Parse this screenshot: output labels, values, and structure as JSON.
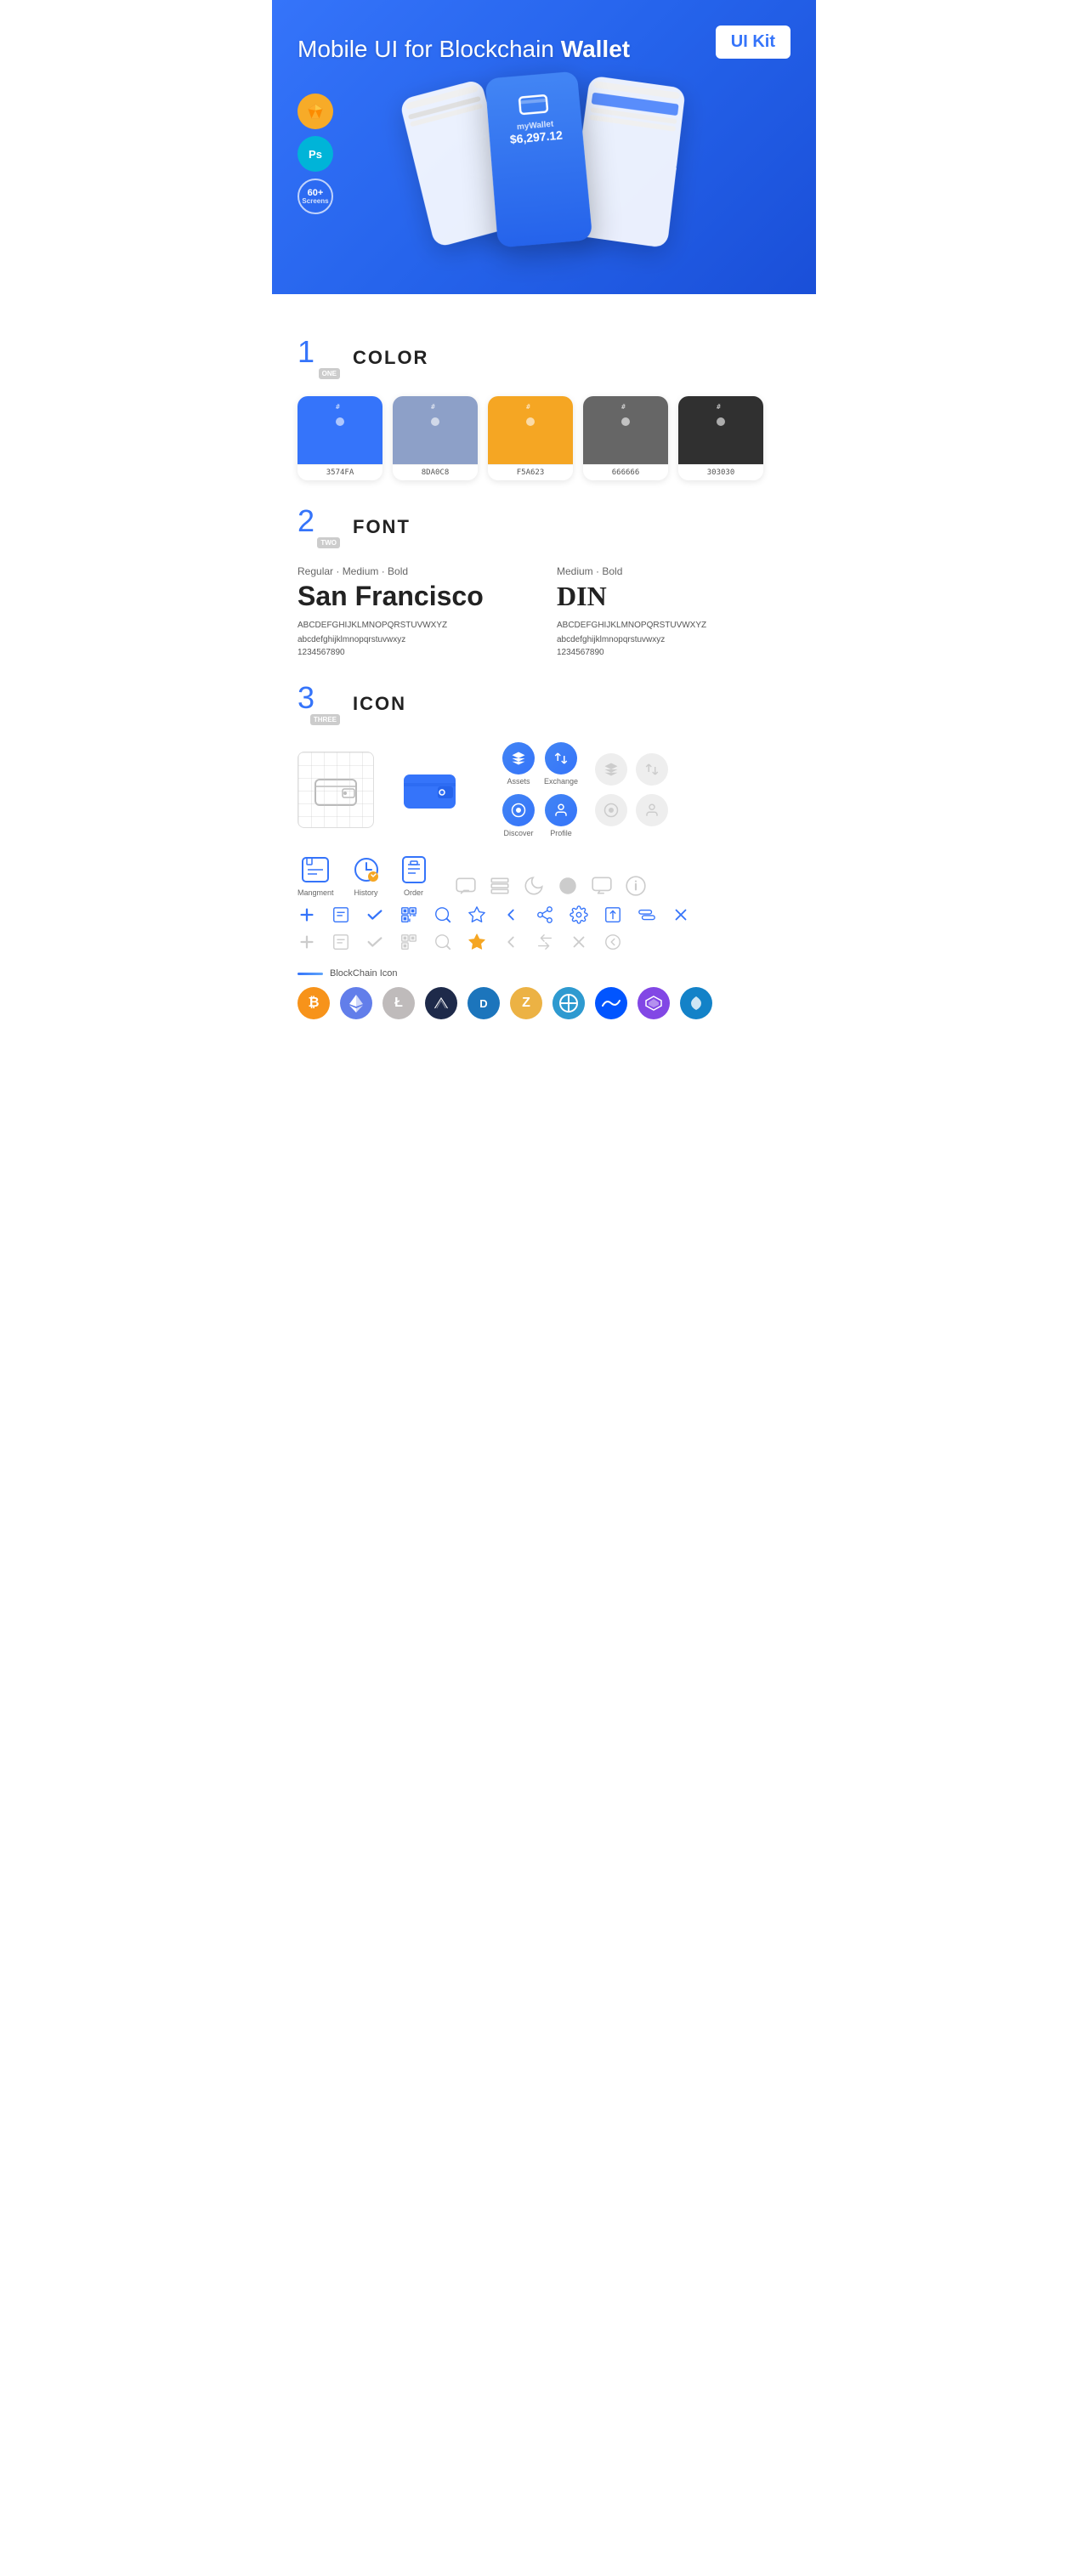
{
  "hero": {
    "title": "Mobile UI for Blockchain ",
    "title_bold": "Wallet",
    "badge": "UI Kit",
    "sketch_label": "Sk",
    "ps_label": "Ps",
    "screens_label": "60+\nScreens"
  },
  "section1": {
    "number": "1",
    "word": "ONE",
    "title": "COLOR",
    "colors": [
      {
        "hex": "#3574FA",
        "label": "3574FA"
      },
      {
        "hex": "#8DA0C8",
        "label": "8DA0C8"
      },
      {
        "hex": "#F5A623",
        "label": "F5A623"
      },
      {
        "hex": "#666666",
        "label": "666666"
      },
      {
        "hex": "#303030",
        "label": "303030"
      }
    ]
  },
  "section2": {
    "number": "2",
    "word": "TWO",
    "title": "FONT",
    "font1": {
      "style": "Regular · Medium · Bold",
      "name": "San Francisco",
      "uppercase": "ABCDEFGHIJKLMNOPQRSTUVWXYZ",
      "lowercase": "abcdefghijklmnopqrstuvwxyz",
      "numbers": "1234567890"
    },
    "font2": {
      "style": "Medium · Bold",
      "name": "DIN",
      "uppercase": "ABCDEFGHIJKLMNOPQRSTUVWXYZ",
      "lowercase": "abcdefghijklmnopqrstuvwxyz",
      "numbers": "1234567890"
    }
  },
  "section3": {
    "number": "3",
    "word": "THREE",
    "title": "ICON",
    "nav_icons": [
      {
        "label": "Mangment"
      },
      {
        "label": "History"
      },
      {
        "label": "Order"
      }
    ],
    "tab_icons": [
      {
        "label": "Assets"
      },
      {
        "label": "Exchange"
      },
      {
        "label": "Discover"
      },
      {
        "label": "Profile"
      }
    ],
    "blockchain_label": "BlockChain Icon",
    "crypto_coins": [
      "BTC",
      "ETH",
      "LTC",
      "WINGS",
      "DASH",
      "ZEN",
      "QTUM",
      "WAVES",
      "POL",
      "STRAT"
    ]
  }
}
